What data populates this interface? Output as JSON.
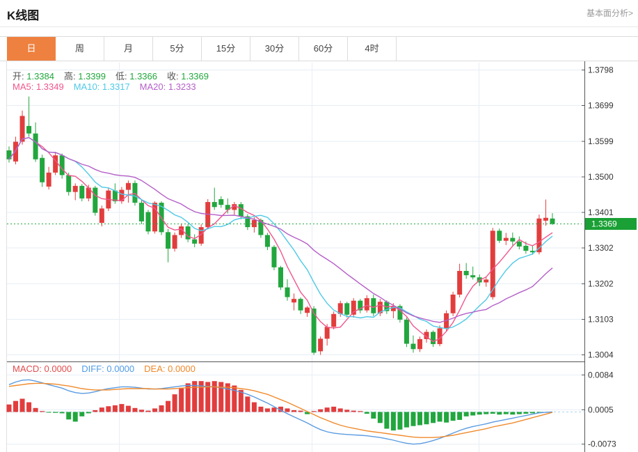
{
  "header": {
    "title": "K线图",
    "link": "基本面分析>"
  },
  "tabs": {
    "items": [
      {
        "name": "tab-day",
        "label": "日",
        "selected": true
      },
      {
        "name": "tab-week",
        "label": "周",
        "selected": false
      },
      {
        "name": "tab-month",
        "label": "月",
        "selected": false
      },
      {
        "name": "tab-5min",
        "label": "5分",
        "selected": false
      },
      {
        "name": "tab-15min",
        "label": "15分",
        "selected": false
      },
      {
        "name": "tab-30min",
        "label": "30分",
        "selected": false
      },
      {
        "name": "tab-60min",
        "label": "60分",
        "selected": false
      },
      {
        "name": "tab-4hour",
        "label": "4时",
        "selected": false
      }
    ]
  },
  "legend": {
    "ohlc": [
      {
        "label": "开:",
        "value": "1.3384"
      },
      {
        "label": "高:",
        "value": "1.3399"
      },
      {
        "label": "低:",
        "value": "1.3366"
      },
      {
        "label": "收:",
        "value": "1.3369"
      }
    ],
    "ohlc_value_color": "#21a73c",
    "ma": [
      {
        "label": "MA5:",
        "value": "1.3349",
        "color": "#f0558d"
      },
      {
        "label": "MA10:",
        "value": "1.3317",
        "color": "#4ec9e6"
      },
      {
        "label": "MA20:",
        "value": "1.3233",
        "color": "#b55fc8"
      }
    ],
    "macd": [
      {
        "label": "MACD:",
        "value": "0.0000",
        "color": "#e24c4c"
      },
      {
        "label": "DIFF:",
        "value": "0.0000",
        "color": "#4f9be6"
      },
      {
        "label": "DEA:",
        "value": "0.0000",
        "color": "#f0882a"
      }
    ]
  },
  "price_badge": {
    "value": "1.3369",
    "color": "#1aa035"
  },
  "colors": {
    "up": "#e23d3d",
    "down": "#22a63e",
    "ma5": "#f0558d",
    "ma10": "#4ec9e6",
    "ma20": "#b55fc8",
    "diff": "#5b9be0",
    "dea": "#f08a2c",
    "grid": "#e7eef5",
    "axis": "#555555",
    "tick_label": "#333333",
    "current_line": "#22a63e",
    "macd_zero_line": "#a8d2ee",
    "tab_accent": "#ee8140"
  },
  "chart_data": [
    {
      "type": "candlestick",
      "title": "K线图 daily candles (OHLC), price rising from left peak 1.367, falling to 1.300 bottom, recovering to 1.3369",
      "ylabel": "price",
      "ylim": [
        1.2985,
        1.382
      ],
      "y_ticks": [
        "1.3798",
        "1.3699",
        "1.3599",
        "1.3500",
        "1.3401",
        "1.3302",
        "1.3202",
        "1.3103",
        "1.3004"
      ],
      "current_price": 1.3369,
      "ma_windows": [
        5,
        10,
        20
      ],
      "grid": true,
      "candles_ohlc": [
        [
          1.3574,
          1.3585,
          1.354,
          1.3549
        ],
        [
          1.3543,
          1.3612,
          1.3535,
          1.3598
        ],
        [
          1.3598,
          1.3685,
          1.359,
          1.367
        ],
        [
          1.3642,
          1.3724,
          1.3612,
          1.3621
        ],
        [
          1.3621,
          1.3652,
          1.3542,
          1.3549
        ],
        [
          1.3553,
          1.3562,
          1.3472,
          1.3485
        ],
        [
          1.3473,
          1.3528,
          1.3465,
          1.3512
        ],
        [
          1.3512,
          1.357,
          1.3505,
          1.356
        ],
        [
          1.356,
          1.3565,
          1.3495,
          1.3505
        ],
        [
          1.3505,
          1.3512,
          1.3448,
          1.3458
        ],
        [
          1.3458,
          1.3482,
          1.3435,
          1.3475
        ],
        [
          1.3475,
          1.348,
          1.3432,
          1.344
        ],
        [
          1.344,
          1.3478,
          1.3432,
          1.347
        ],
        [
          1.347,
          1.3475,
          1.3392,
          1.34
        ],
        [
          1.3372,
          1.342,
          1.3362,
          1.3412
        ],
        [
          1.3412,
          1.347,
          1.3405,
          1.3462
        ],
        [
          1.3462,
          1.3482,
          1.3425,
          1.3432
        ],
        [
          1.3432,
          1.3472,
          1.3425,
          1.3464
        ],
        [
          1.3464,
          1.349,
          1.3428,
          1.3483
        ],
        [
          1.3483,
          1.349,
          1.342,
          1.3428
        ],
        [
          1.3428,
          1.3435,
          1.3368,
          1.3376
        ],
        [
          1.3402,
          1.3408,
          1.334,
          1.3348
        ],
        [
          1.3348,
          1.3432,
          1.3342,
          1.3428
        ],
        [
          1.3428,
          1.3432,
          1.3338,
          1.3346
        ],
        [
          1.3346,
          1.3355,
          1.3262,
          1.33
        ],
        [
          1.33,
          1.3345,
          1.3292,
          1.3338
        ],
        [
          1.3338,
          1.337,
          1.333,
          1.3362
        ],
        [
          1.3362,
          1.3368,
          1.3318,
          1.3326
        ],
        [
          1.3326,
          1.334,
          1.3304,
          1.3314
        ],
        [
          1.3314,
          1.3368,
          1.3308,
          1.336
        ],
        [
          1.336,
          1.3438,
          1.3355,
          1.343
        ],
        [
          1.343,
          1.347,
          1.3408,
          1.3416
        ],
        [
          1.3438,
          1.3446,
          1.3414,
          1.3422
        ],
        [
          1.3422,
          1.344,
          1.3398,
          1.3408
        ],
        [
          1.3408,
          1.343,
          1.3395,
          1.3424
        ],
        [
          1.3424,
          1.343,
          1.3382,
          1.339
        ],
        [
          1.339,
          1.3396,
          1.3352,
          1.336
        ],
        [
          1.336,
          1.3388,
          1.3345,
          1.338
        ],
        [
          1.338,
          1.3384,
          1.333,
          1.3338
        ],
        [
          1.3338,
          1.3344,
          1.3296,
          1.3305
        ],
        [
          1.3305,
          1.331,
          1.324,
          1.3248
        ],
        [
          1.3248,
          1.3252,
          1.3185,
          1.3192
        ],
        [
          1.3192,
          1.3215,
          1.3155,
          1.3165
        ],
        [
          1.315,
          1.3175,
          1.3128,
          1.316
        ],
        [
          1.316,
          1.3164,
          1.3118,
          1.3128
        ],
        [
          1.3121,
          1.314,
          1.311,
          1.3136
        ],
        [
          1.3133,
          1.314,
          1.3004,
          1.301
        ],
        [
          1.3014,
          1.3055,
          1.3004,
          1.3049
        ],
        [
          1.3049,
          1.309,
          1.303,
          1.3082
        ],
        [
          1.3082,
          1.3125,
          1.3075,
          1.3118
        ],
        [
          1.3118,
          1.3155,
          1.311,
          1.3148
        ],
        [
          1.3148,
          1.3152,
          1.3108,
          1.3116
        ],
        [
          1.3116,
          1.3162,
          1.3108,
          1.3155
        ],
        [
          1.3155,
          1.316,
          1.312,
          1.3128
        ],
        [
          1.3128,
          1.317,
          1.3122,
          1.3162
        ],
        [
          1.3162,
          1.3172,
          1.3112,
          1.312
        ],
        [
          1.312,
          1.316,
          1.3112,
          1.3152
        ],
        [
          1.3152,
          1.3156,
          1.3118,
          1.3126
        ],
        [
          1.3126,
          1.3148,
          1.3106,
          1.314
        ],
        [
          1.314,
          1.3145,
          1.3094,
          1.3102
        ],
        [
          1.3102,
          1.3108,
          1.3026,
          1.3035
        ],
        [
          1.3035,
          1.3058,
          1.301,
          1.302
        ],
        [
          1.302,
          1.3055,
          1.3012,
          1.3048
        ],
        [
          1.3048,
          1.3075,
          1.3038,
          1.3068
        ],
        [
          1.3068,
          1.3072,
          1.3026,
          1.3034
        ],
        [
          1.3034,
          1.3086,
          1.3028,
          1.3078
        ],
        [
          1.3078,
          1.3128,
          1.307,
          1.312
        ],
        [
          1.312,
          1.318,
          1.3112,
          1.3172
        ],
        [
          1.3172,
          1.3258,
          1.3164,
          1.3238
        ],
        [
          1.3238,
          1.326,
          1.3216,
          1.3226
        ],
        [
          1.3226,
          1.325,
          1.3214,
          1.322
        ],
        [
          1.322,
          1.3228,
          1.3196,
          1.3206
        ],
        [
          1.3206,
          1.3222,
          1.3194,
          1.3214
        ],
        [
          1.3165,
          1.3358,
          1.3158,
          1.335
        ],
        [
          1.335,
          1.3356,
          1.3316,
          1.3322
        ],
        [
          1.3322,
          1.3344,
          1.331,
          1.333
        ],
        [
          1.333,
          1.3345,
          1.3308,
          1.332
        ],
        [
          1.332,
          1.3334,
          1.3298,
          1.3306
        ],
        [
          1.3308,
          1.332,
          1.3286,
          1.3294
        ],
        [
          1.3294,
          1.331,
          1.3283,
          1.329
        ],
        [
          1.329,
          1.3395,
          1.3284,
          1.3384
        ],
        [
          1.3378,
          1.3437,
          1.3364,
          1.3386
        ],
        [
          1.3384,
          1.3399,
          1.3366,
          1.3369
        ]
      ]
    },
    {
      "type": "bar",
      "title": "MACD pane: histogram bars with DIFF and DEA lines",
      "y_ticks": [
        "0.0084",
        "0.0005",
        "-0.0073"
      ],
      "ylim": [
        -0.009,
        0.0092
      ],
      "bars": [
        0.0017,
        0.0025,
        0.003,
        0.0022,
        0.0009,
        0.0002,
        -0.0001,
        -0.0002,
        -0.0003,
        -0.0017,
        -0.0022,
        -0.001,
        -0.0003,
        0.0004,
        0.001,
        0.0013,
        0.0015,
        0.0018,
        0.0014,
        0.0009,
        0.0005,
        0.0003,
        0.0008,
        0.0015,
        0.0025,
        0.004,
        0.0055,
        0.0065,
        0.007,
        0.007,
        0.0068,
        0.007,
        0.0068,
        0.0065,
        0.006,
        0.005,
        0.0035,
        0.0022,
        0.0012,
        0.0008,
        0.001,
        0.0012,
        0.0008,
        0.0004,
        0.0003,
        -0.0005,
        0.0002,
        0.0006,
        0.001,
        0.0012,
        0.0008,
        0.0005,
        0.0003,
        0.0002,
        -0.0004,
        -0.0015,
        -0.0025,
        -0.0038,
        -0.0042,
        -0.004,
        -0.0035,
        -0.0032,
        -0.003,
        -0.0028,
        -0.0025,
        -0.0022,
        -0.0024,
        -0.002,
        -0.0018,
        -0.001,
        -0.0008,
        -0.0006,
        -0.0005,
        -0.0004,
        -0.0006,
        -0.0005,
        -0.0006,
        -0.0005,
        -0.0004,
        -0.0003,
        -0.0001,
        0.0,
        0.0
      ],
      "series": [
        {
          "name": "DIFF",
          "values": [
            0.0062,
            0.0068,
            0.0072,
            0.0073,
            0.007,
            0.0066,
            0.0062,
            0.0058,
            0.0054,
            0.0048,
            0.0044,
            0.0042,
            0.0043,
            0.0046,
            0.005,
            0.0053,
            0.0055,
            0.0057,
            0.0057,
            0.0056,
            0.0054,
            0.0052,
            0.0052,
            0.0053,
            0.0055,
            0.0057,
            0.0059,
            0.006,
            0.006,
            0.0059,
            0.0058,
            0.0057,
            0.0055,
            0.0052,
            0.0049,
            0.0045,
            0.004,
            0.0034,
            0.0027,
            0.002,
            0.0012,
            0.0004,
            -0.0004,
            -0.0011,
            -0.0018,
            -0.0025,
            -0.0033,
            -0.004,
            -0.0045,
            -0.0048,
            -0.005,
            -0.0051,
            -0.0052,
            -0.0053,
            -0.0054,
            -0.0056,
            -0.0058,
            -0.0061,
            -0.0064,
            -0.0068,
            -0.0071,
            -0.0073,
            -0.0072,
            -0.0069,
            -0.0065,
            -0.006,
            -0.0054,
            -0.0048,
            -0.0042,
            -0.0037,
            -0.0033,
            -0.003,
            -0.0027,
            -0.0023,
            -0.002,
            -0.0017,
            -0.0014,
            -0.0011,
            -0.0008,
            -0.0005,
            -0.0002,
            -0.0001,
            0.0
          ]
        },
        {
          "name": "DEA",
          "values": [
            0.0058,
            0.006,
            0.0062,
            0.0064,
            0.0065,
            0.0065,
            0.0064,
            0.0063,
            0.0061,
            0.0059,
            0.0056,
            0.0053,
            0.0051,
            0.005,
            0.005,
            0.005,
            0.0051,
            0.0052,
            0.0053,
            0.0053,
            0.0053,
            0.0053,
            0.0052,
            0.0052,
            0.0052,
            0.0053,
            0.0054,
            0.0055,
            0.0056,
            0.0056,
            0.0057,
            0.0057,
            0.0056,
            0.0056,
            0.0055,
            0.0053,
            0.0051,
            0.0048,
            0.0044,
            0.004,
            0.0034,
            0.0028,
            0.0022,
            0.0015,
            0.0008,
            0.0001,
            -0.0006,
            -0.0013,
            -0.0019,
            -0.0025,
            -0.003,
            -0.0034,
            -0.0037,
            -0.004,
            -0.0043,
            -0.0045,
            -0.0047,
            -0.0049,
            -0.0051,
            -0.0053,
            -0.0055,
            -0.0057,
            -0.0058,
            -0.0058,
            -0.0058,
            -0.0057,
            -0.0055,
            -0.0053,
            -0.005,
            -0.0047,
            -0.0044,
            -0.0041,
            -0.0038,
            -0.0034,
            -0.0031,
            -0.0028,
            -0.0025,
            -0.0021,
            -0.0017,
            -0.0013,
            -0.0009,
            -0.0005,
            -0.0001
          ]
        }
      ]
    }
  ]
}
